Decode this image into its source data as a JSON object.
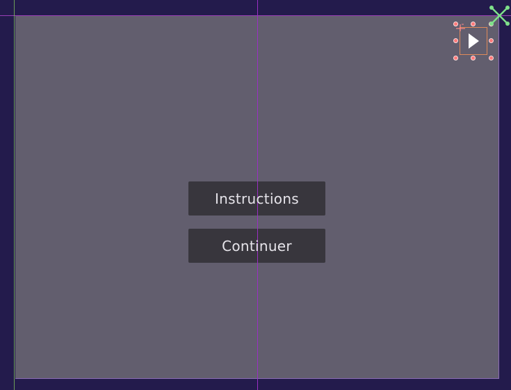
{
  "menu": {
    "instructions_label": "Instructions",
    "continue_label": "Continuer"
  },
  "colors": {
    "editor_background": "#231b4c",
    "canvas_fill": "#625e6e",
    "button_fill": "#38363d",
    "button_text": "#e6e4ea",
    "guide_purple": "#9b2fc4",
    "selection_orange": "#e08a5a",
    "handle_red": "#ff7a7a",
    "anchor_green": "#7fe08a"
  },
  "icons": {
    "selected_node": "play-icon",
    "anchor": "anchor-icon",
    "pivot": "pivot-icon"
  }
}
